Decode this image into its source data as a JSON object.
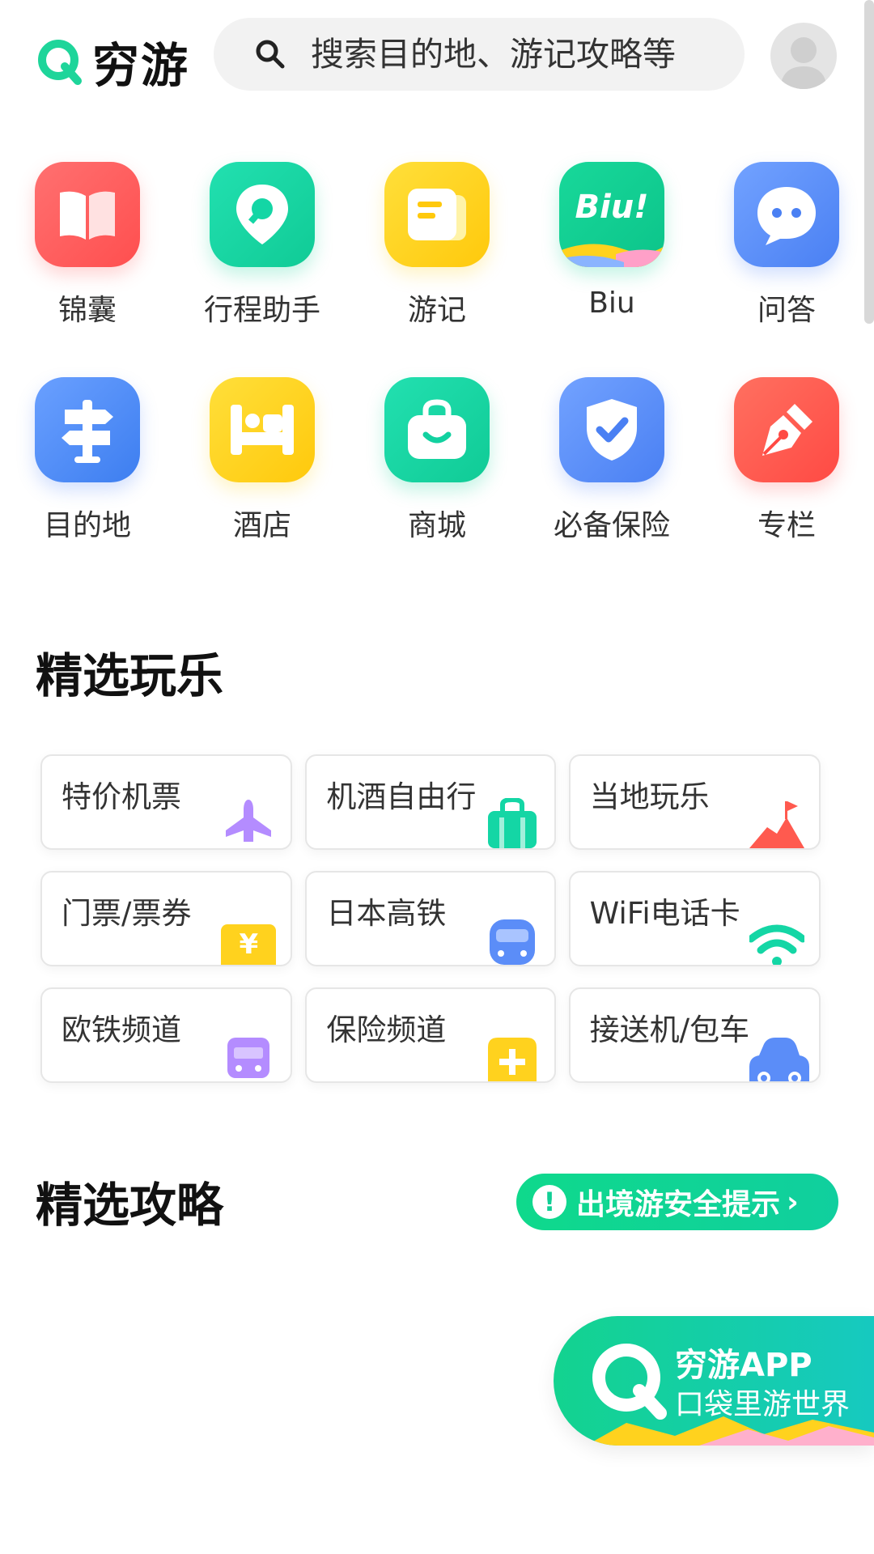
{
  "brand": {
    "logo_text": "穷游",
    "accent": "#1ed59a"
  },
  "search": {
    "placeholder": "搜索目的地、游记攻略等"
  },
  "grid": {
    "row1": [
      {
        "label": "锦囊",
        "icon": "book-icon",
        "color": "#ff5d5d"
      },
      {
        "label": "行程助手",
        "icon": "location-pin-icon",
        "color": "#14d6a5"
      },
      {
        "label": "游记",
        "icon": "notes-icon",
        "color": "#ffd21e"
      },
      {
        "label": "Biu",
        "icon": "biu-icon",
        "color": "#10cf92",
        "icon_text": "Biu!"
      },
      {
        "label": "问答",
        "icon": "chat-bubble-icon",
        "color": "#5b8df8"
      }
    ],
    "row2": [
      {
        "label": "目的地",
        "icon": "signpost-icon",
        "color": "#4f8ef7"
      },
      {
        "label": "酒店",
        "icon": "bed-icon",
        "color": "#ffd21e"
      },
      {
        "label": "商城",
        "icon": "shopping-bag-icon",
        "color": "#12d1a0"
      },
      {
        "label": "必备保险",
        "icon": "shield-check-icon",
        "color": "#5b8df8"
      },
      {
        "label": "专栏",
        "icon": "pen-nib-icon",
        "color": "#ff5a4f"
      }
    ]
  },
  "play": {
    "title": "精选玩乐",
    "cards": [
      {
        "label": "特价机票",
        "icon": "airplane-icon",
        "color": "#b48cff"
      },
      {
        "label": "机酒自由行",
        "icon": "suitcase-icon",
        "color": "#14d6a5"
      },
      {
        "label": "当地玩乐",
        "icon": "mountain-flag-icon",
        "color": "#ff5a4f"
      },
      {
        "label": "门票/票券",
        "icon": "yen-ticket-icon",
        "color": "#ffd21e",
        "icon_text": "¥"
      },
      {
        "label": "日本高铁",
        "icon": "train-icon",
        "color": "#5b8df8"
      },
      {
        "label": "WiFi电话卡",
        "icon": "wifi-icon",
        "color": "#14d6a5"
      },
      {
        "label": "欧铁频道",
        "icon": "rail-icon",
        "color": "#b48cff"
      },
      {
        "label": "保险频道",
        "icon": "medical-plus-icon",
        "color": "#ffd21e"
      },
      {
        "label": "接送机/包车",
        "icon": "car-icon",
        "color": "#5b8df8"
      }
    ]
  },
  "guides": {
    "title": "精选攻略",
    "safety_button": "出境游安全提示",
    "safety_icon_text": "!",
    "chevron": "›"
  },
  "banner": {
    "title": "穷游APP",
    "subtitle": "口袋里游世界"
  }
}
